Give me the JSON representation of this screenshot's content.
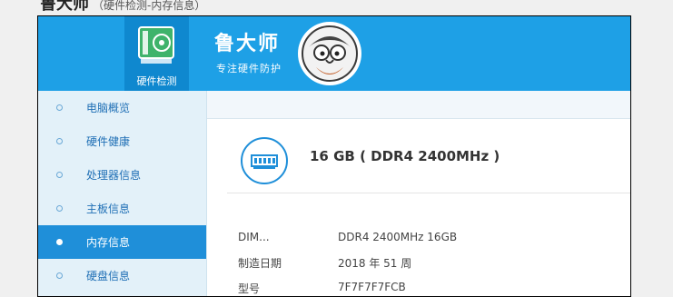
{
  "page_heading": {
    "title": "鲁大师",
    "subtitle": "（硬件检测-内存信息）"
  },
  "banner": {
    "tab_label": "硬件检测",
    "brand_name": "鲁大师",
    "brand_slogan": "专注硬件防护"
  },
  "sidebar": {
    "items": [
      {
        "label": "电脑概览",
        "active": false
      },
      {
        "label": "硬件健康",
        "active": false
      },
      {
        "label": "处理器信息",
        "active": false
      },
      {
        "label": "主板信息",
        "active": false
      },
      {
        "label": "内存信息",
        "active": true
      },
      {
        "label": "硬盘信息",
        "active": false
      }
    ]
  },
  "memory": {
    "title": "16 GB ( DDR4 2400MHz )",
    "specs": [
      {
        "key": "DIM...",
        "value": "DDR4 2400MHz 16GB"
      },
      {
        "key": "制造日期",
        "value": "2018 年 51 周"
      },
      {
        "key": "型号",
        "value": "7F7F7F7FCB"
      }
    ]
  },
  "colors": {
    "banner": "#1ea0e6",
    "tab_active": "#0f88cf",
    "sidebar_bg": "#e3f1f9",
    "nav_active": "#1f8fd9",
    "accent": "#1f8fd9"
  },
  "icons": [
    "motherboard-icon",
    "mascot-avatar-icon",
    "memory-module-icon",
    "nav-dot-icon"
  ]
}
